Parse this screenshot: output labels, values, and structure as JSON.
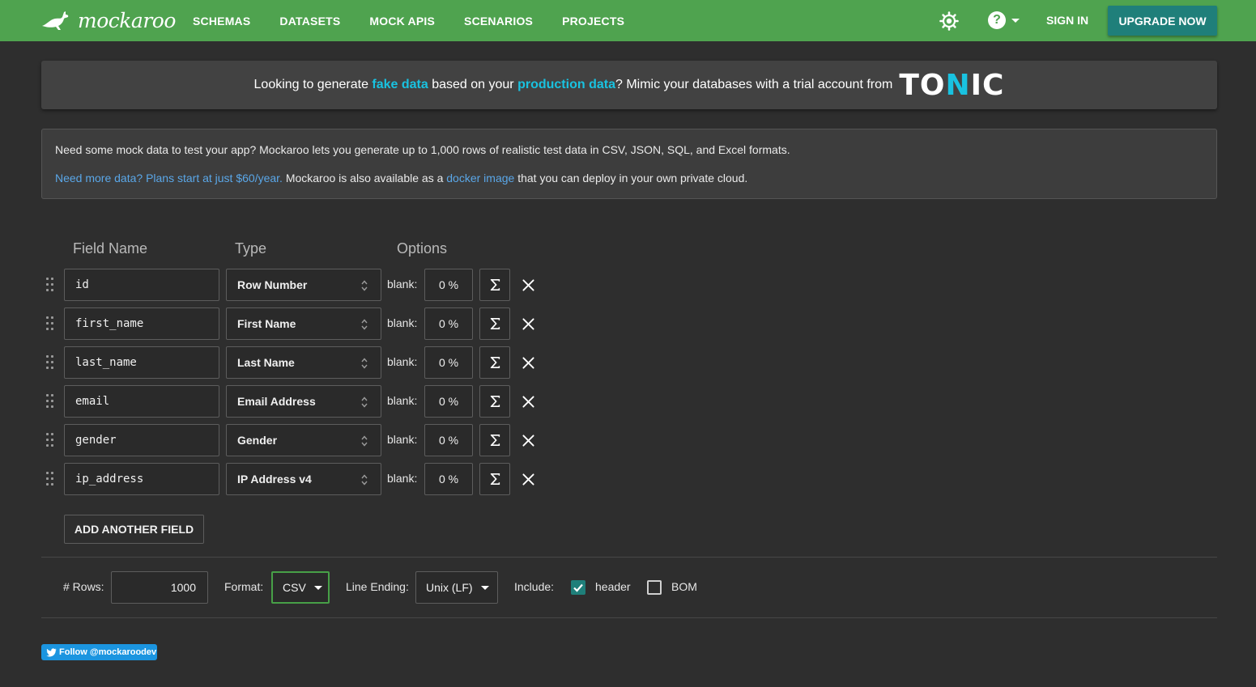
{
  "nav": {
    "logo_text": "mockaroo",
    "links": [
      "SCHEMAS",
      "DATASETS",
      "MOCK APIS",
      "SCENARIOS",
      "PROJECTS"
    ],
    "help_label": "?",
    "signin": "SIGN IN",
    "upgrade": "UPGRADE NOW",
    "icons": [
      "kangaroo-logo-icon",
      "brightness-icon",
      "help-icon",
      "chevron-down-icon"
    ]
  },
  "banner": {
    "t1": "Looking to generate ",
    "hl1": "fake data",
    "t2": " based on your ",
    "hl2": "production data",
    "t3": "? Mimic your databases with a trial account from",
    "logo_to": "TO",
    "logo_n": "N",
    "logo_ic": "IC"
  },
  "info": {
    "line1": "Need some mock data to test your app? Mockaroo lets you generate up to 1,000 rows of realistic test data in CSV, JSON, SQL, and Excel formats.",
    "link1": "Need more data? Plans start at just $60/year.",
    "t2": " Mockaroo is also available as a ",
    "link2": "docker image",
    "t3": " that you can deploy in your own private cloud."
  },
  "columns": {
    "field_name": "Field Name",
    "type": "Type",
    "options": "Options"
  },
  "fields": [
    {
      "name": "id",
      "type": "Row Number",
      "blank_label": "blank:",
      "blank": "0 %"
    },
    {
      "name": "first_name",
      "type": "First Name",
      "blank_label": "blank:",
      "blank": "0 %"
    },
    {
      "name": "last_name",
      "type": "Last Name",
      "blank_label": "blank:",
      "blank": "0 %"
    },
    {
      "name": "email",
      "type": "Email Address",
      "blank_label": "blank:",
      "blank": "0 %"
    },
    {
      "name": "gender",
      "type": "Gender",
      "blank_label": "blank:",
      "blank": "0 %"
    },
    {
      "name": "ip_address",
      "type": "IP Address v4",
      "blank_label": "blank:",
      "blank": "0 %"
    }
  ],
  "add_field": "ADD ANOTHER FIELD",
  "controls": {
    "rows_label": "# Rows:",
    "rows_value": "1000",
    "format_label": "Format:",
    "format_value": "CSV",
    "line_ending_label": "Line Ending:",
    "line_ending_value": "Unix (LF)",
    "include_label": "Include:",
    "header_label": "header",
    "header_checked": true,
    "bom_label": "BOM",
    "bom_checked": false
  },
  "twitter": {
    "label": "Follow @mockaroodev"
  },
  "colors": {
    "nav": "#4fa34f",
    "upgrade": "#1f7f7a",
    "highlight": "#19c2e0",
    "link": "#5aa7e8",
    "background": "#2e2e2e"
  }
}
